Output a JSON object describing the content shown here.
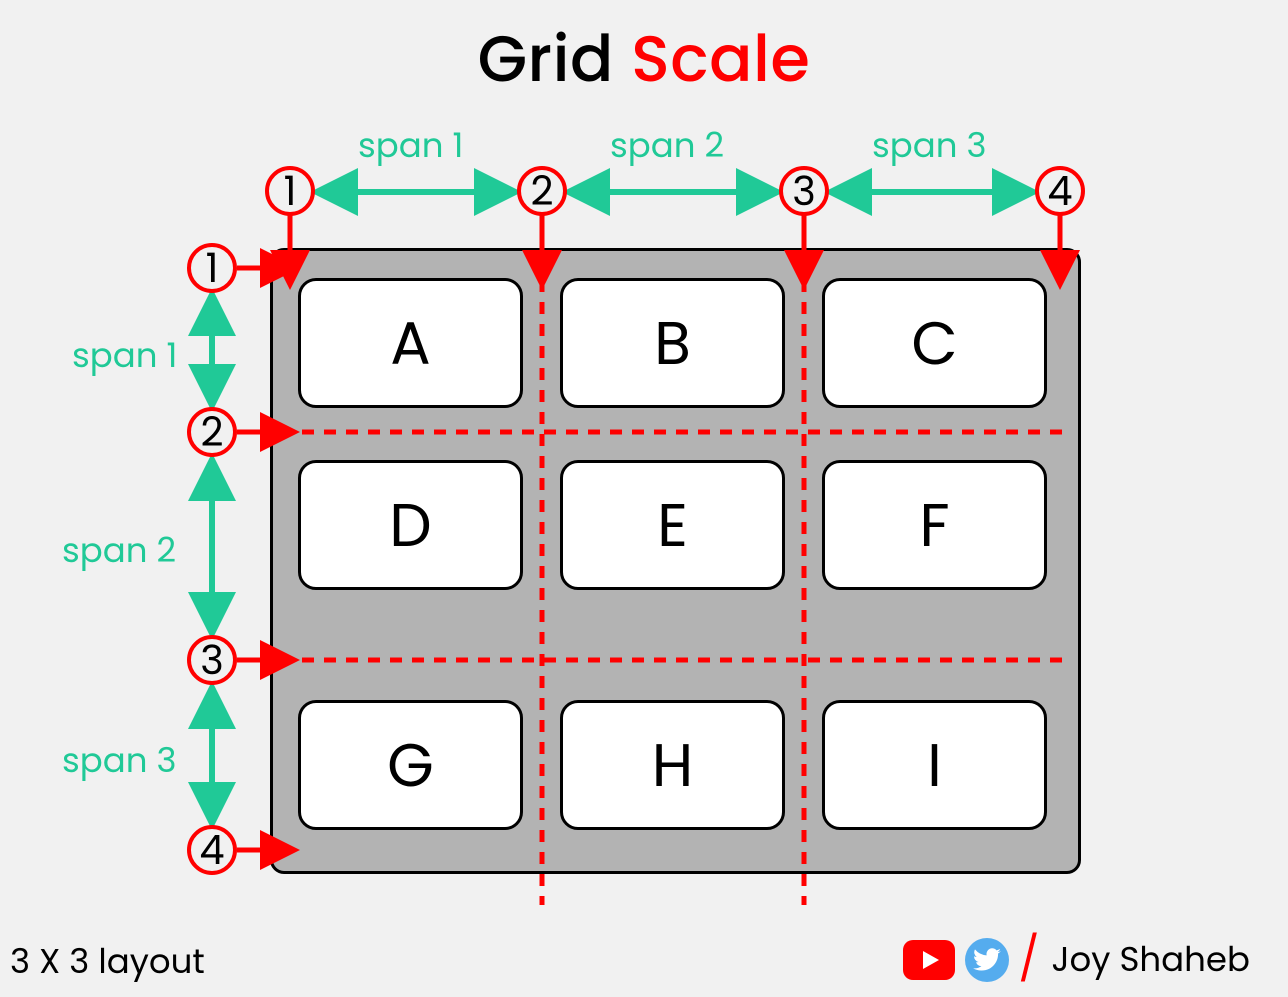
{
  "title": {
    "part1": "Grid ",
    "part2": "Scale"
  },
  "accent_color": "#ff0000",
  "span_color": "#20c997",
  "columns": {
    "lines": [
      "1",
      "2",
      "3",
      "4"
    ],
    "spans": [
      "span 1",
      "span 2",
      "span 3"
    ]
  },
  "rows": {
    "lines": [
      "1",
      "2",
      "3",
      "4"
    ],
    "spans": [
      "span 1",
      "span 2",
      "span 3"
    ]
  },
  "cells": [
    "A",
    "B",
    "C",
    "D",
    "E",
    "F",
    "G",
    "H",
    "I"
  ],
  "footer_left": "3 X 3 layout",
  "author": "Joy Shaheb",
  "layout_hint": "3x3 CSS Grid. Column lines 1–4, row lines 1–4. Each span is the gap between consecutive lines."
}
